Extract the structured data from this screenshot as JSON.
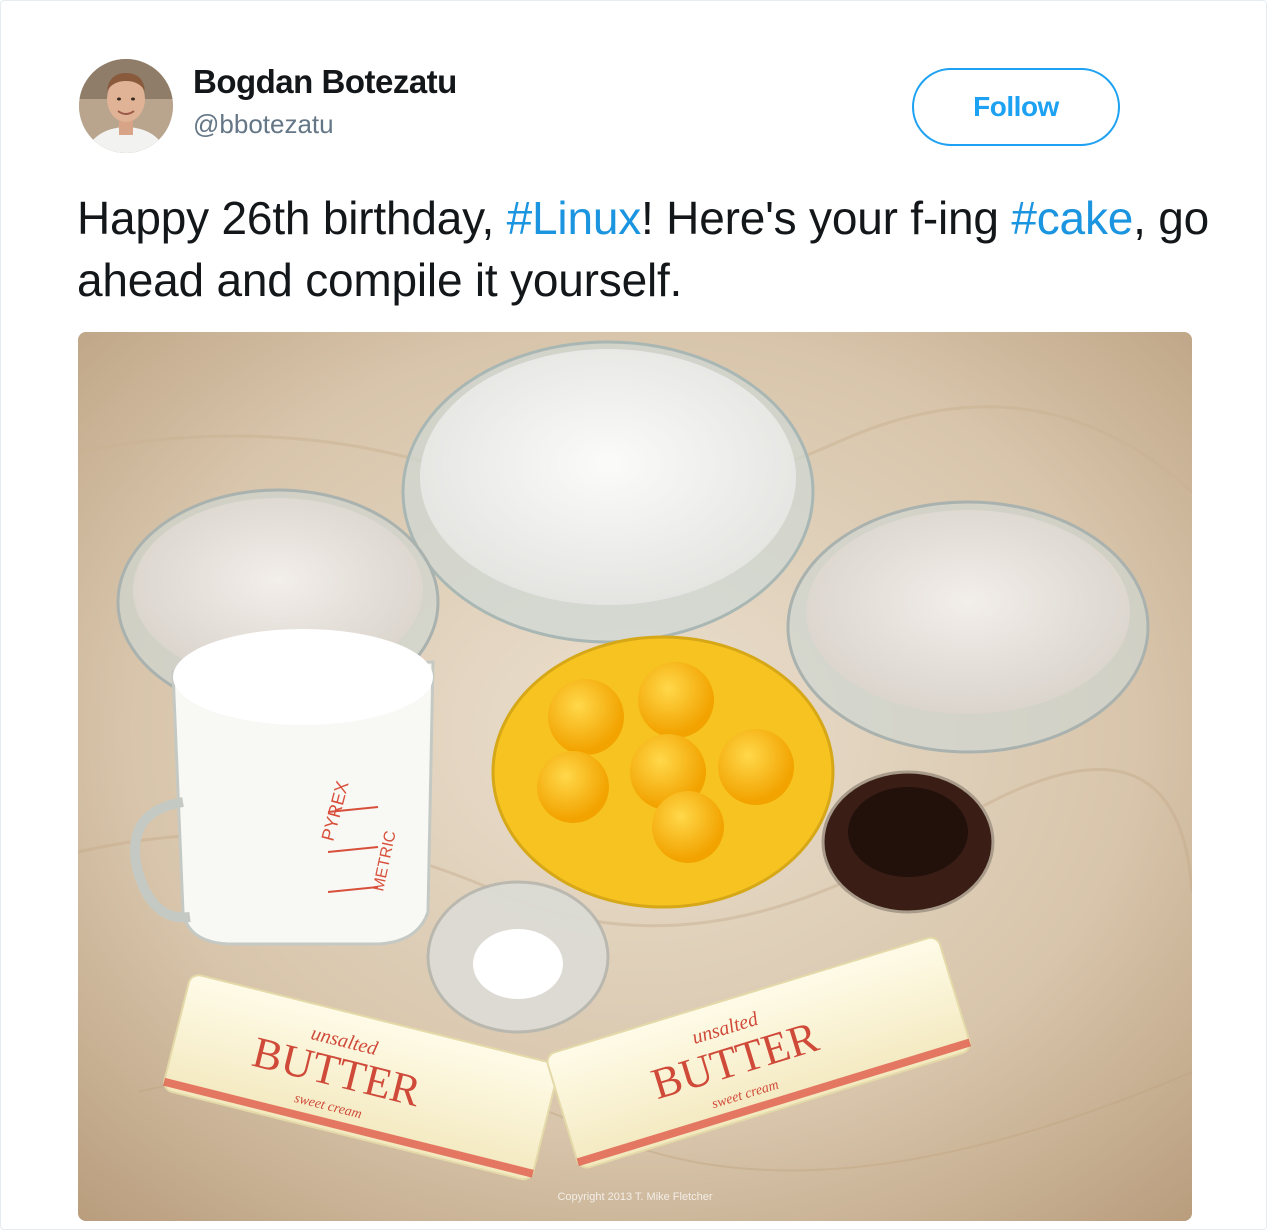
{
  "author": {
    "name": "Bogdan Botezatu",
    "handle": "@bbotezatu",
    "avatar_icon": "user-avatar"
  },
  "follow_button": {
    "label": "Follow",
    "color": "#1da1f2"
  },
  "tweet": {
    "text_part_1": "Happy 26th birthday, ",
    "hashtag_1": "#Linux",
    "text_part_2": "! Here's your f-ing ",
    "hashtag_2": "#cake",
    "text_part_3": ", go ahead and compile it yourself.",
    "hashtag_color": "#1b95e0"
  },
  "media": {
    "description_icon": "cake-ingredients-photo",
    "watermark": "Copyright 2013 T. Mike Fletcher",
    "butter_label_top": "unsalted",
    "butter_label_main": "BUTTER",
    "butter_label_sub": "sweet cream",
    "cup_brand": "PYREX",
    "cup_metric": "METRIC"
  }
}
